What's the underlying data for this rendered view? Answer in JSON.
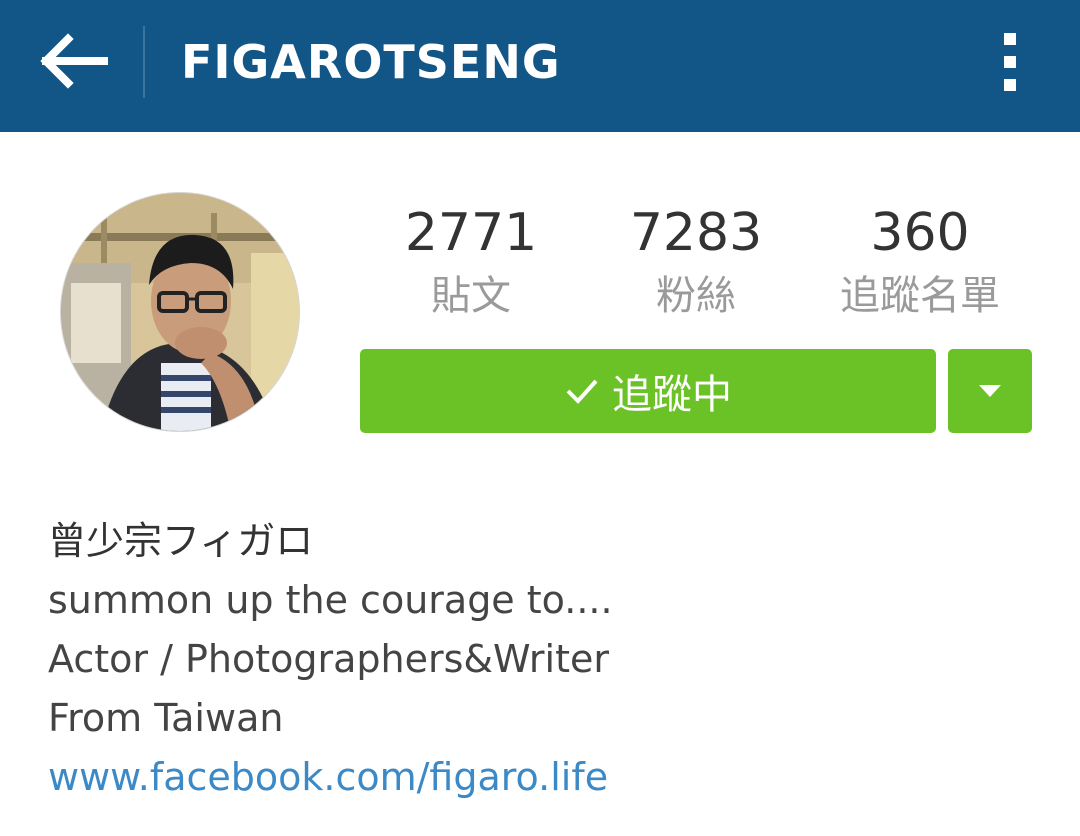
{
  "header": {
    "username": "FIGAROTSENG",
    "back_icon": "arrow-left-icon",
    "menu_icon": "more-vertical-icon",
    "background_color": "#125688"
  },
  "profile": {
    "avatar_icon": "profile-photo",
    "stats": [
      {
        "value": "2771",
        "label": "貼文"
      },
      {
        "value": "7283",
        "label": "粉絲"
      },
      {
        "value": "360",
        "label": "追蹤名單"
      }
    ],
    "follow_button": {
      "label": "追蹤中",
      "icon": "checkmark-icon",
      "color": "#6bc226"
    },
    "dropdown_icon": "caret-down-icon"
  },
  "bio": {
    "full_name": "曾少宗フィガロ",
    "lines": [
      "summon up the courage to....",
      "Actor / Photographers&Writer",
      "From Taiwan"
    ],
    "link": "www.facebook.com/figaro.life",
    "link_color": "#3b89c6"
  }
}
